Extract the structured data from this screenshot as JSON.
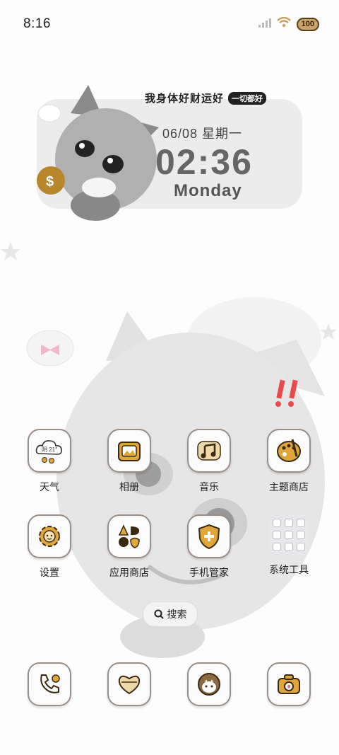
{
  "status": {
    "time": "8:16",
    "battery": "100"
  },
  "widget": {
    "banner_main": "我身体好财运好",
    "banner_sub": "一切都好",
    "date": "06/08 星期一",
    "time": "02:36",
    "day": "Monday",
    "weather_text": "阴 21°"
  },
  "apps": [
    {
      "label": "天气"
    },
    {
      "label": "相册"
    },
    {
      "label": "音乐"
    },
    {
      "label": "主题商店"
    },
    {
      "label": "设置"
    },
    {
      "label": "应用商店"
    },
    {
      "label": "手机管家"
    },
    {
      "label": "系统工具"
    }
  ],
  "search": {
    "label": "搜索"
  }
}
